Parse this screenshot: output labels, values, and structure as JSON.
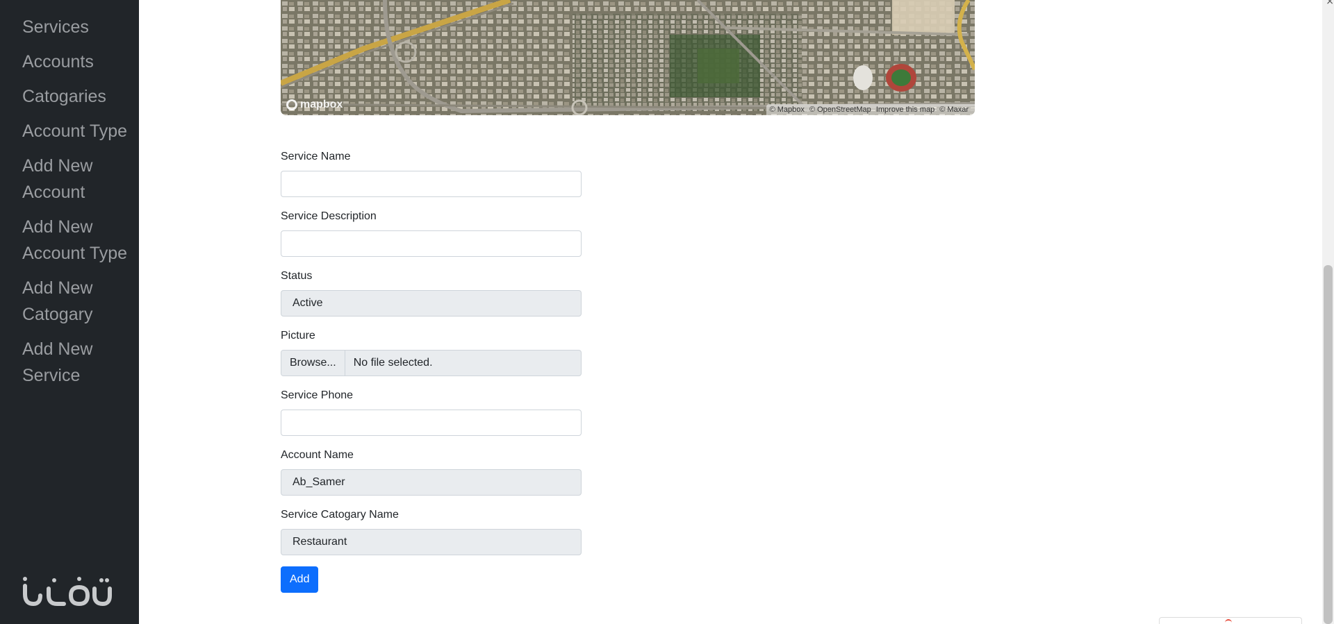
{
  "sidebar": {
    "items": [
      {
        "label": "Services"
      },
      {
        "label": "Accounts"
      },
      {
        "label": "Catogaries"
      },
      {
        "label": "Account Type"
      },
      {
        "label": "Add New Account"
      },
      {
        "label": "Add New Account Type"
      },
      {
        "label": "Add New Catogary"
      },
      {
        "label": "Add New Service"
      }
    ],
    "logo_icon": "brand-logo-icon"
  },
  "map": {
    "logo_text": "mapbox",
    "attribution": {
      "mapbox": "© Mapbox",
      "osm": "© OpenStreetMap",
      "improve": "Improve this map",
      "maxar": "© Maxar"
    }
  },
  "form": {
    "service_name": {
      "label": "Service Name",
      "value": ""
    },
    "service_description": {
      "label": "Service Description",
      "value": ""
    },
    "status": {
      "label": "Status",
      "value": "Active"
    },
    "picture": {
      "label": "Picture",
      "browse": "Browse...",
      "file_name": "No file selected."
    },
    "service_phone": {
      "label": "Service Phone",
      "value": ""
    },
    "account_name": {
      "label": "Account Name",
      "value": "Ab_Samer"
    },
    "category_name": {
      "label": "Service Catogary Name",
      "value": "Restaurant"
    },
    "submit_label": "Add"
  },
  "colors": {
    "sidebar_bg": "#212529",
    "sidebar_text": "#9a9da1",
    "primary": "#0d6efd",
    "disabled_bg": "#e9ecef"
  }
}
